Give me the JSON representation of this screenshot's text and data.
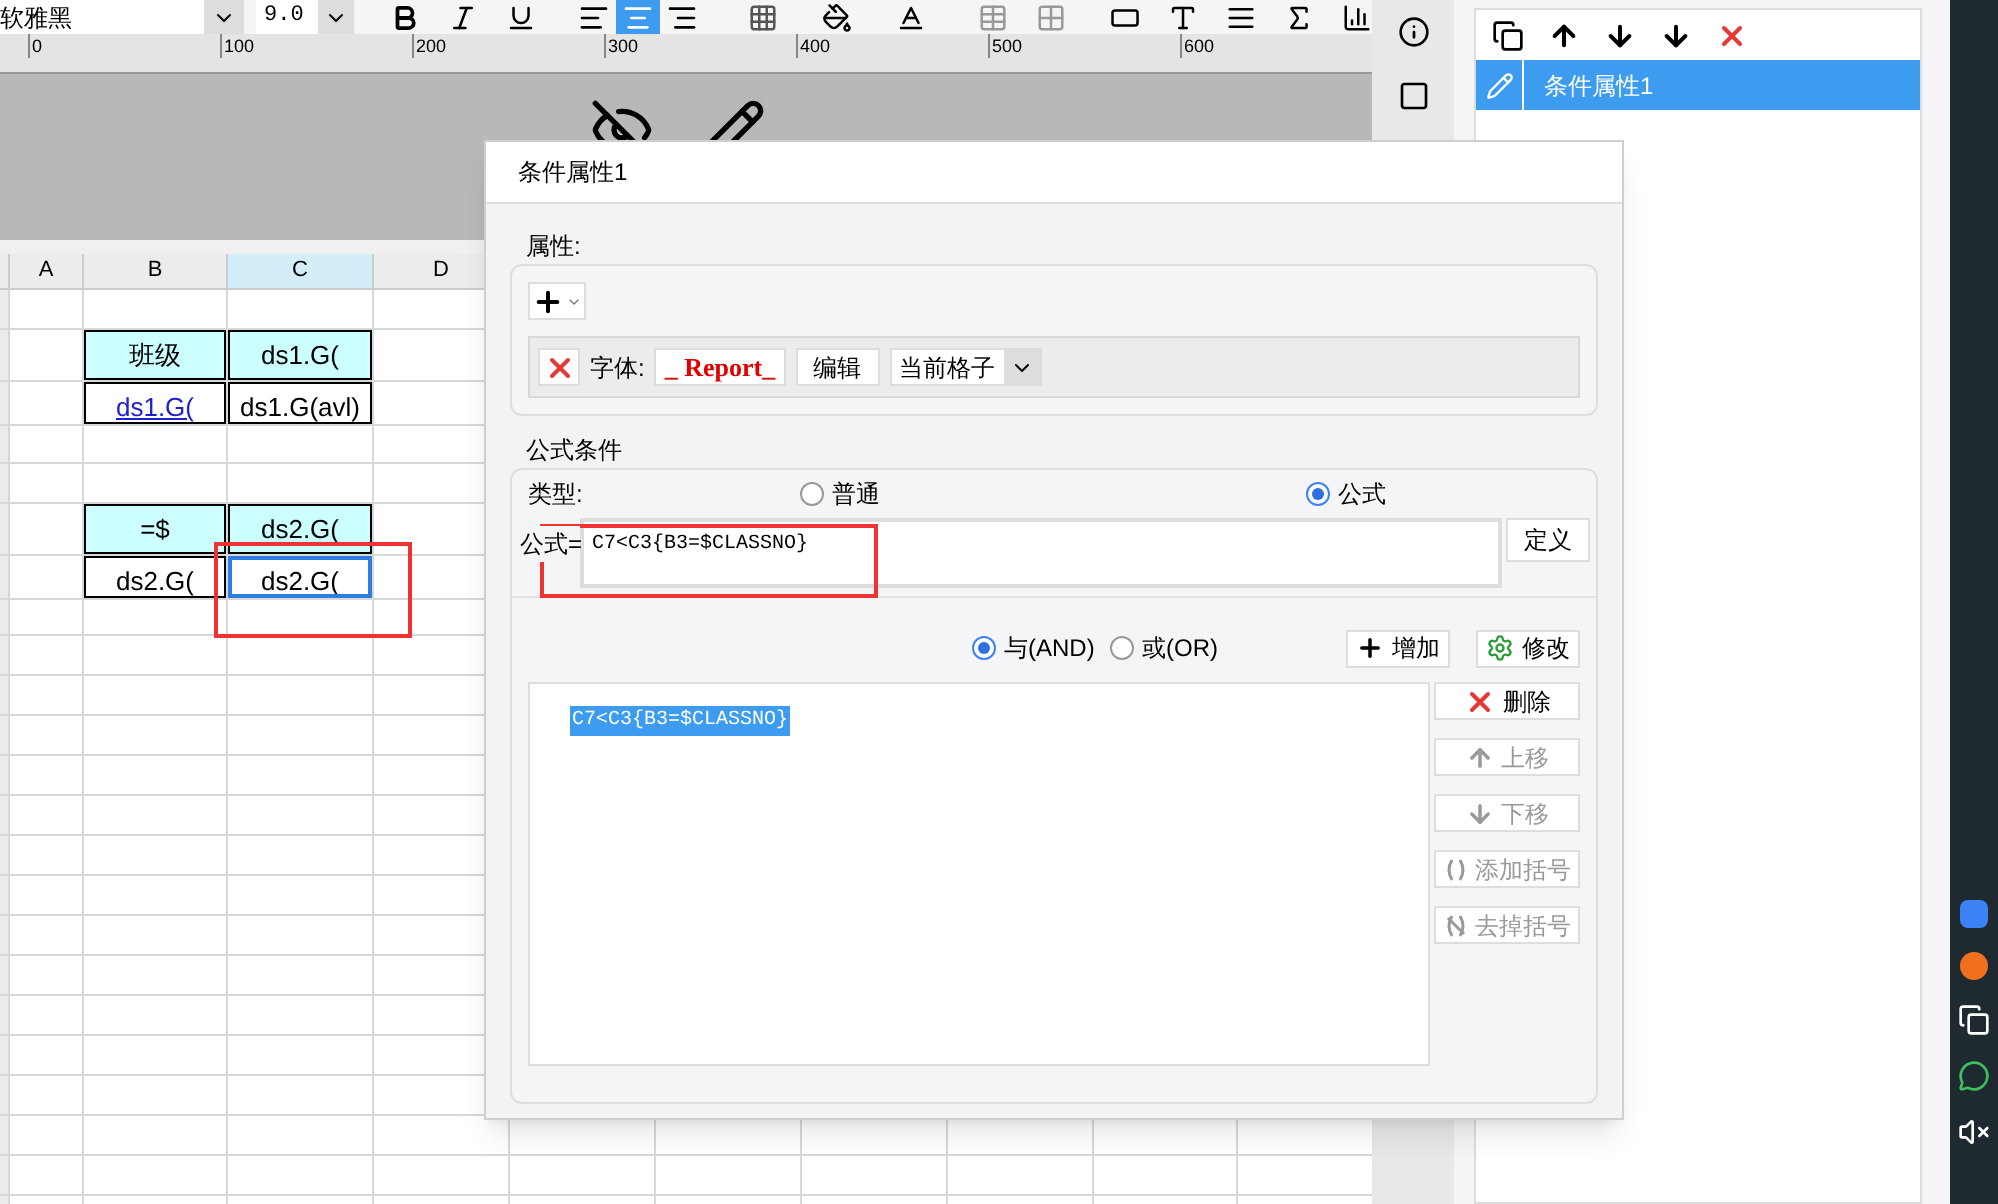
{
  "toolbar": {
    "font": "软雅黑",
    "size": "9.0",
    "align": [
      {
        "selected": false
      },
      {
        "selected": true
      },
      {
        "selected": false
      }
    ]
  },
  "ruler": {
    "ticks": [
      "0",
      "100",
      "200",
      "300",
      "400",
      "500",
      "600"
    ]
  },
  "sheet": {
    "columns": [
      {
        "label": "A",
        "selected": false
      },
      {
        "label": "B",
        "selected": false
      },
      {
        "label": "C",
        "selected": true
      },
      {
        "label": "D",
        "selected": false
      }
    ],
    "tables": [
      {
        "rows": [
          [
            {
              "text": "班级",
              "kind": "header",
              "selected": false
            },
            {
              "text": "ds1.G(",
              "kind": "header",
              "selected": false
            }
          ],
          [
            {
              "text": "ds1.G(",
              "kind": "link",
              "selected": false
            },
            {
              "text": "ds1.G(avl)",
              "kind": "data",
              "selected": false
            }
          ]
        ]
      },
      {
        "rows": [
          [
            {
              "text": "=$",
              "kind": "header",
              "selected": false
            },
            {
              "text": "ds2.G(",
              "kind": "header",
              "selected": false
            }
          ],
          [
            {
              "text": "ds2.G(",
              "kind": "data",
              "selected": false
            },
            {
              "text": "ds2.G(",
              "kind": "data",
              "selected": true
            }
          ]
        ]
      }
    ]
  },
  "dialog": {
    "title": "条件属性1",
    "attributes": {
      "legend": "属性:",
      "font_label": "字体:",
      "font_preview": "_ Report_",
      "edit_button": "编辑",
      "scope": "当前格子"
    },
    "formula_condition": {
      "legend": "公式条件",
      "type_label": "类型:",
      "types": [
        {
          "label": "普通",
          "selected": false
        },
        {
          "label": "公式",
          "selected": true
        }
      ],
      "formula_label": "公式=",
      "formula": "C7<C3{B3=$CLASSNO}",
      "define_button": "定义"
    },
    "logic": [
      {
        "label": "与(AND)",
        "selected": true
      },
      {
        "label": "或(OR)",
        "selected": false
      }
    ],
    "add_button": "增加",
    "modify_button": "修改",
    "conditions": [
      {
        "text": "C7<C3{B3=$CLASSNO}",
        "selected": true
      }
    ],
    "side_buttons": [
      {
        "label": "删除",
        "kind": "delete",
        "disabled": false
      },
      {
        "label": "上移",
        "kind": "up",
        "disabled": true
      },
      {
        "label": "下移",
        "kind": "down",
        "disabled": true
      },
      {
        "label": "添加括号",
        "kind": "paren",
        "disabled": true
      },
      {
        "label": "去掉括号",
        "kind": "unparen",
        "disabled": true
      }
    ]
  },
  "conditions_panel": {
    "items": [
      {
        "label": "条件属性1",
        "selected": true
      }
    ]
  }
}
